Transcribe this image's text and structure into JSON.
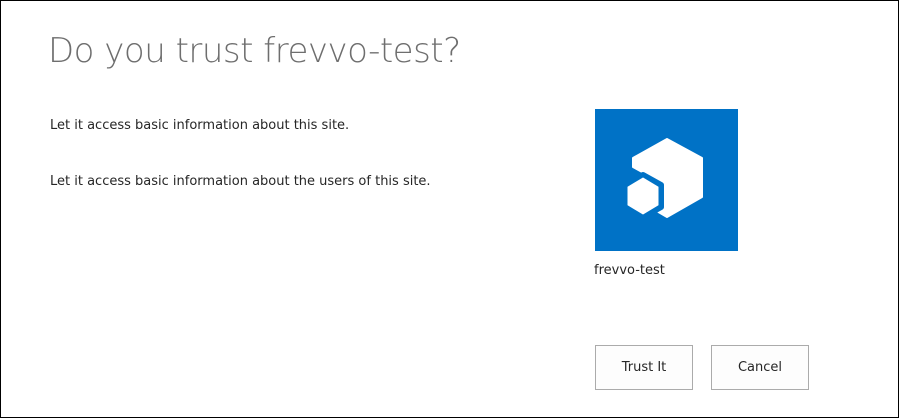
{
  "dialog": {
    "title": "Do you trust frevvo-test?",
    "permissions": [
      "Let it access basic information about this site.",
      "Let it access basic information about the users of this site."
    ],
    "app": {
      "name": "frevvo-test",
      "icon": "app-hexagon-icon",
      "tile_color": "#0072c6"
    },
    "buttons": {
      "trust_label": "Trust It",
      "cancel_label": "Cancel"
    }
  }
}
